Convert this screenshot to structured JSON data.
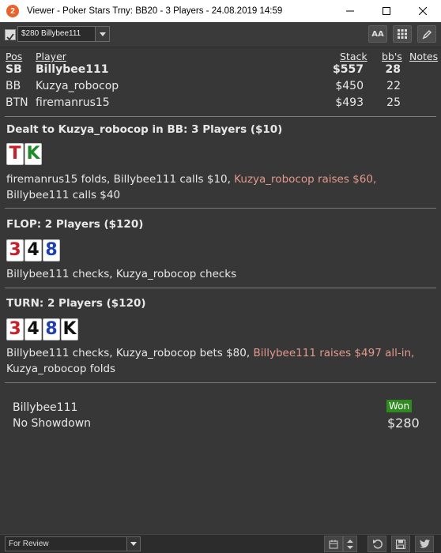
{
  "window": {
    "title": "Viewer - Poker Stars Trny: BB20 - 3 Players - 24.08.2019 14:59",
    "app_icon_text": "2",
    "accent": "#e8632a"
  },
  "toolbar": {
    "selected_player": "$280 Billybee111",
    "font_button_label": "AA"
  },
  "players_table": {
    "headers": {
      "pos": "Pos",
      "player": "Player",
      "stack": "Stack",
      "bbs": "bb's",
      "notes": "Notes"
    },
    "rows": [
      {
        "pos": "SB",
        "player": "Billybee111",
        "stack": "$557",
        "bbs": "28"
      },
      {
        "pos": "BB",
        "player": "Kuzya_robocop",
        "stack": "$450",
        "bbs": "22"
      },
      {
        "pos": "BTN",
        "player": "firemanrus15",
        "stack": "$493",
        "bbs": "25"
      }
    ]
  },
  "preflop": {
    "title": "Dealt to Kuzya_robocop in BB: 3 Players ($10)",
    "cards": [
      {
        "rank": "T",
        "color": "#c8202a"
      },
      {
        "rank": "K",
        "color": "#1e8a2a"
      }
    ],
    "action_1": "firemanrus15 folds, Billybee111 calls $10, ",
    "action_raise": "Kuzya_robocop raises $60,",
    "action_2": " Billybee111 calls $40"
  },
  "flop": {
    "title": "FLOP: 2 Players ($120)",
    "cards": [
      {
        "rank": "3",
        "color": "#c8202a"
      },
      {
        "rank": "4",
        "color": "#111111"
      },
      {
        "rank": "8",
        "color": "#1f3fb5"
      }
    ],
    "action": "Billybee111 checks, Kuzya_robocop checks"
  },
  "turn": {
    "title": "TURN: 2 Players ($120)",
    "cards": [
      {
        "rank": "3",
        "color": "#c8202a"
      },
      {
        "rank": "4",
        "color": "#111111"
      },
      {
        "rank": "8",
        "color": "#1f3fb5"
      },
      {
        "rank": "K",
        "color": "#111111"
      }
    ],
    "action_1": "Billybee111 checks, Kuzya_robocop bets $80, ",
    "action_raise": "Billybee111 raises $497 all-in,",
    "action_2": " Kuzya_robocop folds",
    "raise_color": "#e49a8c"
  },
  "summary": {
    "winner": "Billybee111",
    "result": "No Showdown",
    "won_label": "Won",
    "won_amount": "$280",
    "badge_color": "#2f8a20"
  },
  "statusbar": {
    "review_select": "For Review"
  }
}
